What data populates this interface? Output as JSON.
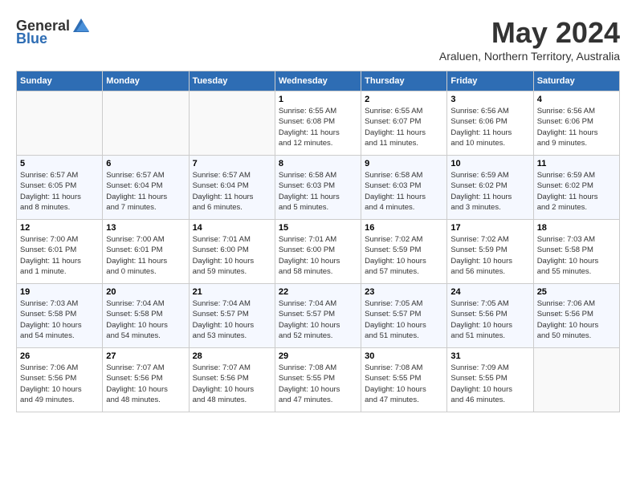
{
  "logo": {
    "general": "General",
    "blue": "Blue"
  },
  "title": "May 2024",
  "subtitle": "Araluen, Northern Territory, Australia",
  "days_of_week": [
    "Sunday",
    "Monday",
    "Tuesday",
    "Wednesday",
    "Thursday",
    "Friday",
    "Saturday"
  ],
  "weeks": [
    [
      {
        "day": "",
        "info": ""
      },
      {
        "day": "",
        "info": ""
      },
      {
        "day": "",
        "info": ""
      },
      {
        "day": "1",
        "info": "Sunrise: 6:55 AM\nSunset: 6:08 PM\nDaylight: 11 hours\nand 12 minutes."
      },
      {
        "day": "2",
        "info": "Sunrise: 6:55 AM\nSunset: 6:07 PM\nDaylight: 11 hours\nand 11 minutes."
      },
      {
        "day": "3",
        "info": "Sunrise: 6:56 AM\nSunset: 6:06 PM\nDaylight: 11 hours\nand 10 minutes."
      },
      {
        "day": "4",
        "info": "Sunrise: 6:56 AM\nSunset: 6:06 PM\nDaylight: 11 hours\nand 9 minutes."
      }
    ],
    [
      {
        "day": "5",
        "info": "Sunrise: 6:57 AM\nSunset: 6:05 PM\nDaylight: 11 hours\nand 8 minutes."
      },
      {
        "day": "6",
        "info": "Sunrise: 6:57 AM\nSunset: 6:04 PM\nDaylight: 11 hours\nand 7 minutes."
      },
      {
        "day": "7",
        "info": "Sunrise: 6:57 AM\nSunset: 6:04 PM\nDaylight: 11 hours\nand 6 minutes."
      },
      {
        "day": "8",
        "info": "Sunrise: 6:58 AM\nSunset: 6:03 PM\nDaylight: 11 hours\nand 5 minutes."
      },
      {
        "day": "9",
        "info": "Sunrise: 6:58 AM\nSunset: 6:03 PM\nDaylight: 11 hours\nand 4 minutes."
      },
      {
        "day": "10",
        "info": "Sunrise: 6:59 AM\nSunset: 6:02 PM\nDaylight: 11 hours\nand 3 minutes."
      },
      {
        "day": "11",
        "info": "Sunrise: 6:59 AM\nSunset: 6:02 PM\nDaylight: 11 hours\nand 2 minutes."
      }
    ],
    [
      {
        "day": "12",
        "info": "Sunrise: 7:00 AM\nSunset: 6:01 PM\nDaylight: 11 hours\nand 1 minute."
      },
      {
        "day": "13",
        "info": "Sunrise: 7:00 AM\nSunset: 6:01 PM\nDaylight: 11 hours\nand 0 minutes."
      },
      {
        "day": "14",
        "info": "Sunrise: 7:01 AM\nSunset: 6:00 PM\nDaylight: 10 hours\nand 59 minutes."
      },
      {
        "day": "15",
        "info": "Sunrise: 7:01 AM\nSunset: 6:00 PM\nDaylight: 10 hours\nand 58 minutes."
      },
      {
        "day": "16",
        "info": "Sunrise: 7:02 AM\nSunset: 5:59 PM\nDaylight: 10 hours\nand 57 minutes."
      },
      {
        "day": "17",
        "info": "Sunrise: 7:02 AM\nSunset: 5:59 PM\nDaylight: 10 hours\nand 56 minutes."
      },
      {
        "day": "18",
        "info": "Sunrise: 7:03 AM\nSunset: 5:58 PM\nDaylight: 10 hours\nand 55 minutes."
      }
    ],
    [
      {
        "day": "19",
        "info": "Sunrise: 7:03 AM\nSunset: 5:58 PM\nDaylight: 10 hours\nand 54 minutes."
      },
      {
        "day": "20",
        "info": "Sunrise: 7:04 AM\nSunset: 5:58 PM\nDaylight: 10 hours\nand 54 minutes."
      },
      {
        "day": "21",
        "info": "Sunrise: 7:04 AM\nSunset: 5:57 PM\nDaylight: 10 hours\nand 53 minutes."
      },
      {
        "day": "22",
        "info": "Sunrise: 7:04 AM\nSunset: 5:57 PM\nDaylight: 10 hours\nand 52 minutes."
      },
      {
        "day": "23",
        "info": "Sunrise: 7:05 AM\nSunset: 5:57 PM\nDaylight: 10 hours\nand 51 minutes."
      },
      {
        "day": "24",
        "info": "Sunrise: 7:05 AM\nSunset: 5:56 PM\nDaylight: 10 hours\nand 51 minutes."
      },
      {
        "day": "25",
        "info": "Sunrise: 7:06 AM\nSunset: 5:56 PM\nDaylight: 10 hours\nand 50 minutes."
      }
    ],
    [
      {
        "day": "26",
        "info": "Sunrise: 7:06 AM\nSunset: 5:56 PM\nDaylight: 10 hours\nand 49 minutes."
      },
      {
        "day": "27",
        "info": "Sunrise: 7:07 AM\nSunset: 5:56 PM\nDaylight: 10 hours\nand 48 minutes."
      },
      {
        "day": "28",
        "info": "Sunrise: 7:07 AM\nSunset: 5:56 PM\nDaylight: 10 hours\nand 48 minutes."
      },
      {
        "day": "29",
        "info": "Sunrise: 7:08 AM\nSunset: 5:55 PM\nDaylight: 10 hours\nand 47 minutes."
      },
      {
        "day": "30",
        "info": "Sunrise: 7:08 AM\nSunset: 5:55 PM\nDaylight: 10 hours\nand 47 minutes."
      },
      {
        "day": "31",
        "info": "Sunrise: 7:09 AM\nSunset: 5:55 PM\nDaylight: 10 hours\nand 46 minutes."
      },
      {
        "day": "",
        "info": ""
      }
    ]
  ]
}
